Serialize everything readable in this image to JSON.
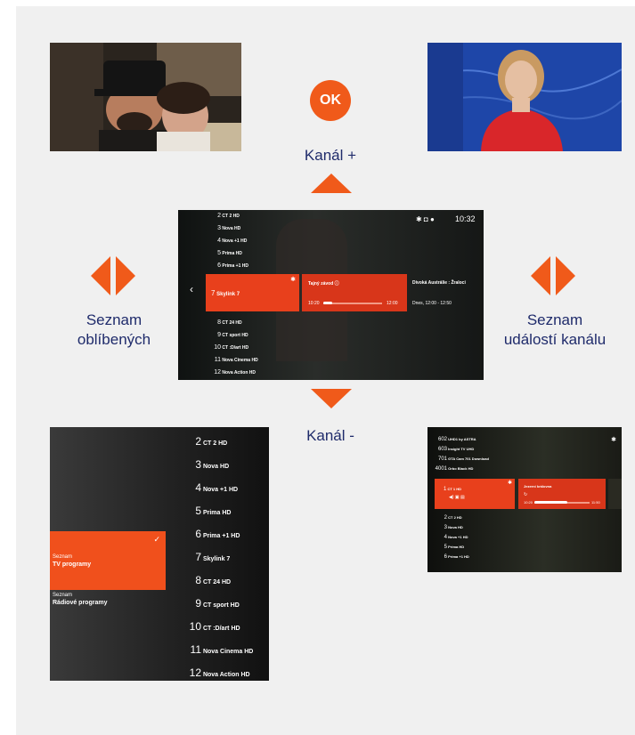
{
  "ok_label": "OK",
  "labels": {
    "channel_up": "Kanál +",
    "channel_down": "Kanál -",
    "favorites_line1": "Seznam",
    "favorites_line2": "oblíbených",
    "events_line1": "Seznam",
    "events_line2": "událostí kanálu"
  },
  "center_screen": {
    "time": "10:32",
    "channels_above": [
      {
        "num": "2",
        "name": "CT 2 HD"
      },
      {
        "num": "3",
        "name": "Nova HD"
      },
      {
        "num": "4",
        "name": "Nova +1 HD"
      },
      {
        "num": "5",
        "name": "Prima HD"
      },
      {
        "num": "6",
        "name": "Prima +1 HD"
      }
    ],
    "selected": {
      "num": "7",
      "name": "Skylink 7"
    },
    "channels_below": [
      {
        "num": "8",
        "name": "CT 24 HD"
      },
      {
        "num": "9",
        "name": "CT sport HD"
      },
      {
        "num": "10",
        "name": "CT :D/art HD"
      },
      {
        "num": "11",
        "name": "Nova Cinema HD"
      },
      {
        "num": "12",
        "name": "Nova Action HD"
      }
    ],
    "now_title": "Tajný závod",
    "now_start": "10:20",
    "now_end": "12:00",
    "now_progress": 0.15,
    "next_title": "Divoká Austrálie : Žraloci",
    "next_time": "Dnes, 12:00 - 12:50"
  },
  "bottom_left": {
    "list_selected_line1": "Seznam",
    "list_selected_line2": "TV programy",
    "list_other_line1": "Seznam",
    "list_other_line2": "Rádiové programy",
    "channels": [
      {
        "num": "2",
        "name": "CT 2 HD"
      },
      {
        "num": "3",
        "name": "Nova HD"
      },
      {
        "num": "4",
        "name": "Nova +1 HD"
      },
      {
        "num": "5",
        "name": "Prima HD"
      },
      {
        "num": "6",
        "name": "Prima +1 HD"
      },
      {
        "num": "7",
        "name": "Skylink 7"
      },
      {
        "num": "8",
        "name": "CT 24 HD"
      },
      {
        "num": "9",
        "name": "CT sport HD"
      },
      {
        "num": "10",
        "name": "CT :D/art HD"
      },
      {
        "num": "11",
        "name": "Nova Cinema HD"
      },
      {
        "num": "12",
        "name": "Nova Action HD"
      }
    ]
  },
  "bottom_right": {
    "channels_above": [
      {
        "num": "602",
        "name": "UHD1 by ASTRA"
      },
      {
        "num": "603",
        "name": "Insight TV UHD"
      },
      {
        "num": "701",
        "name": "GTA Cam 701 Download"
      },
      {
        "num": "4001",
        "name": "Orbo Black HD"
      }
    ],
    "selected": {
      "num": "1",
      "name": "CT 1 HD"
    },
    "now_title": "Jezerní královna",
    "now_start": "10:20",
    "now_end": "11:50",
    "now_progress": 0.6,
    "channels_below": [
      {
        "num": "2",
        "name": "CT 2 HD"
      },
      {
        "num": "3",
        "name": "Nova HD"
      },
      {
        "num": "4",
        "name": "Nova +1 HD"
      },
      {
        "num": "5",
        "name": "Prima HD"
      },
      {
        "num": "6",
        "name": "Prima +1 HD"
      }
    ]
  },
  "colors": {
    "accent": "#f05a1a",
    "label_text": "#1f2b6b",
    "panel_bg": "#f0f0f0"
  }
}
